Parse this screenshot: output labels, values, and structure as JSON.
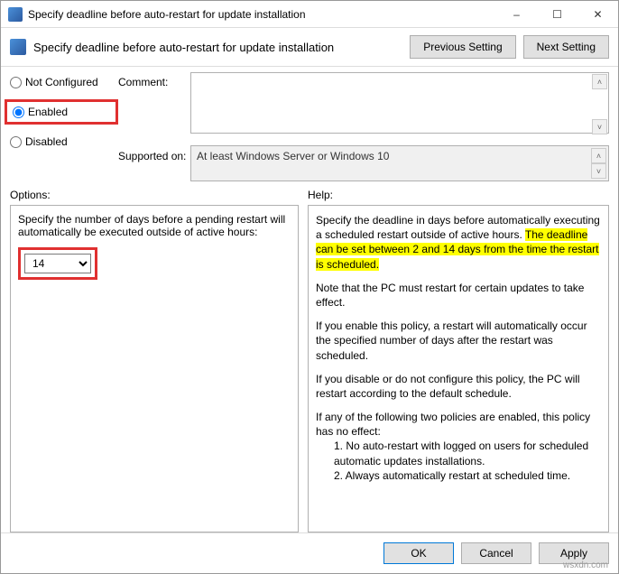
{
  "window": {
    "title": "Specify deadline before auto-restart for update installation"
  },
  "header": {
    "subtitle": "Specify deadline before auto-restart for update installation",
    "previous": "Previous Setting",
    "next": "Next Setting"
  },
  "radios": {
    "not_configured": "Not Configured",
    "enabled": "Enabled",
    "disabled": "Disabled",
    "selected": "enabled"
  },
  "labels": {
    "comment": "Comment:",
    "supported": "Supported on:",
    "options": "Options:",
    "help": "Help:"
  },
  "supported_text": "At least Windows Server or Windows 10",
  "options": {
    "description": "Specify the number of days before a pending restart will automatically be executed outside of active hours:",
    "value": "14"
  },
  "help": {
    "p1a": "Specify the deadline in days before automatically executing a scheduled restart outside of active hours. ",
    "p1b_hl": "The deadline can be set between 2 and 14 days from the time the restart is scheduled.",
    "p2": "Note that the PC must restart for certain updates to take effect.",
    "p3": "If you enable this policy, a restart will automatically occur the specified number of days after the restart was scheduled.",
    "p4": "If you disable or do not configure this policy, the PC will restart according to the default schedule.",
    "p5": "If any of the following two policies are enabled, this policy has no effect:",
    "p5a": "1. No auto-restart with logged on users for scheduled automatic updates installations.",
    "p5b": "2. Always automatically restart at scheduled time."
  },
  "footer": {
    "ok": "OK",
    "cancel": "Cancel",
    "apply": "Apply"
  },
  "watermark": "wsxdn.com"
}
